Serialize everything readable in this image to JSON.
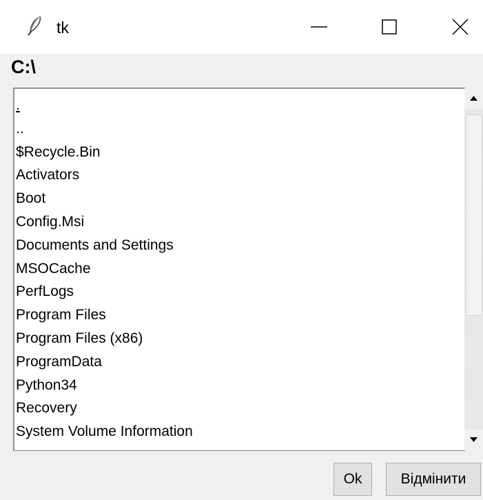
{
  "window": {
    "title": "tk",
    "controls": [
      "minimize",
      "maximize",
      "close"
    ]
  },
  "path_label": "C:\\",
  "listbox": {
    "items": [
      ".",
      "..",
      "$Recycle.Bin",
      "Activators",
      "Boot",
      "Config.Msi",
      "Documents and Settings",
      "MSOCache",
      "PerfLogs",
      "Program Files",
      "Program Files (x86)",
      "ProgramData",
      "Python34",
      "Recovery",
      "System Volume Information"
    ],
    "active_index": 0
  },
  "buttons": {
    "ok_label": "Ok",
    "cancel_label": "Відмінити"
  },
  "icons": {
    "app": "feather-icon",
    "minimize": "minimize-icon",
    "maximize": "maximize-icon",
    "close": "close-icon",
    "scroll_up": "arrow-up-icon",
    "scroll_down": "arrow-down-icon"
  }
}
